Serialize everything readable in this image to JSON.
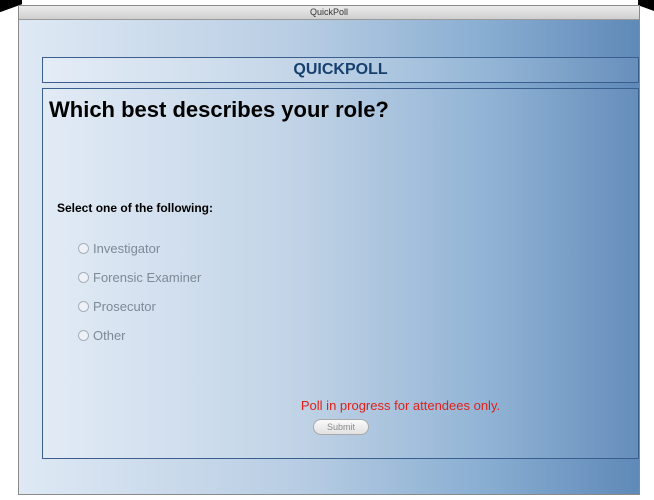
{
  "window": {
    "title": "QuickPoll"
  },
  "poll": {
    "header": "QUICKPOLL",
    "question": "Which best describes your role?",
    "instruction": "Select one of the following:",
    "options": [
      {
        "label": "Investigator",
        "selected": false
      },
      {
        "label": "Forensic Examiner",
        "selected": false
      },
      {
        "label": "Prosecutor",
        "selected": false
      },
      {
        "label": "Other",
        "selected": false
      }
    ],
    "status_message": "Poll in progress for attendees only.",
    "submit_label": "Submit"
  },
  "colors": {
    "header_text": "#17406e",
    "status_text": "#e0201a",
    "option_text_disabled": "#7d8a96",
    "background_left": "#dfe9f5",
    "background_right": "#5f89b8"
  }
}
